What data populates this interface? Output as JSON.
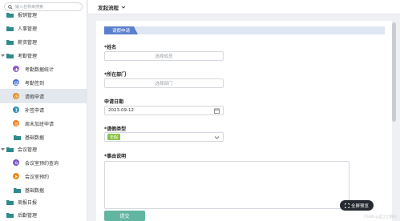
{
  "sidebar": {
    "search_placeholder": "输入名称来搜索",
    "items": [
      {
        "label": "报销管理",
        "kind": "folder"
      },
      {
        "label": "人事管理",
        "kind": "folder"
      },
      {
        "label": "薪资管理",
        "kind": "folder"
      },
      {
        "label": "考勤管理",
        "kind": "folder"
      },
      {
        "label": "考勤数据统计",
        "kind": "sub"
      },
      {
        "label": "考勤签到",
        "kind": "sub"
      },
      {
        "label": "请假申请",
        "kind": "sub"
      },
      {
        "label": "补签申请",
        "kind": "sub"
      },
      {
        "label": "周末加班申请",
        "kind": "sub"
      },
      {
        "label": "基础数据",
        "kind": "folder"
      },
      {
        "label": "会议管理",
        "kind": "folder"
      },
      {
        "label": "会议室预约查询",
        "kind": "sub"
      },
      {
        "label": "会议室预约",
        "kind": "sub"
      },
      {
        "label": "基础数据",
        "kind": "folder"
      },
      {
        "label": "周报日报",
        "kind": "folder"
      },
      {
        "label": "后勤管理",
        "kind": "folder"
      }
    ]
  },
  "topbar": {
    "flow_label": "发起流程"
  },
  "form": {
    "section_title": "请假申请",
    "name_label": "*姓名",
    "name_placeholder": "选择成员",
    "dept_label": "*所在部门",
    "dept_placeholder": "选择部门",
    "date_label": "申请日期",
    "date_value": "2023-09-12",
    "type_label": "*请假类型",
    "type_value": "年假",
    "reason_label": "*事由说明",
    "submit_label": "提交"
  },
  "fullscreen_label": "全屏预览",
  "watermark": "CSDN @蓝卫士静态",
  "colors": {
    "accent": "#5b7fcf",
    "submit": "#62b5a1",
    "tag": "#8bc34a",
    "folder": "#2e8b8b",
    "selected_row": "#e3e8ef"
  }
}
